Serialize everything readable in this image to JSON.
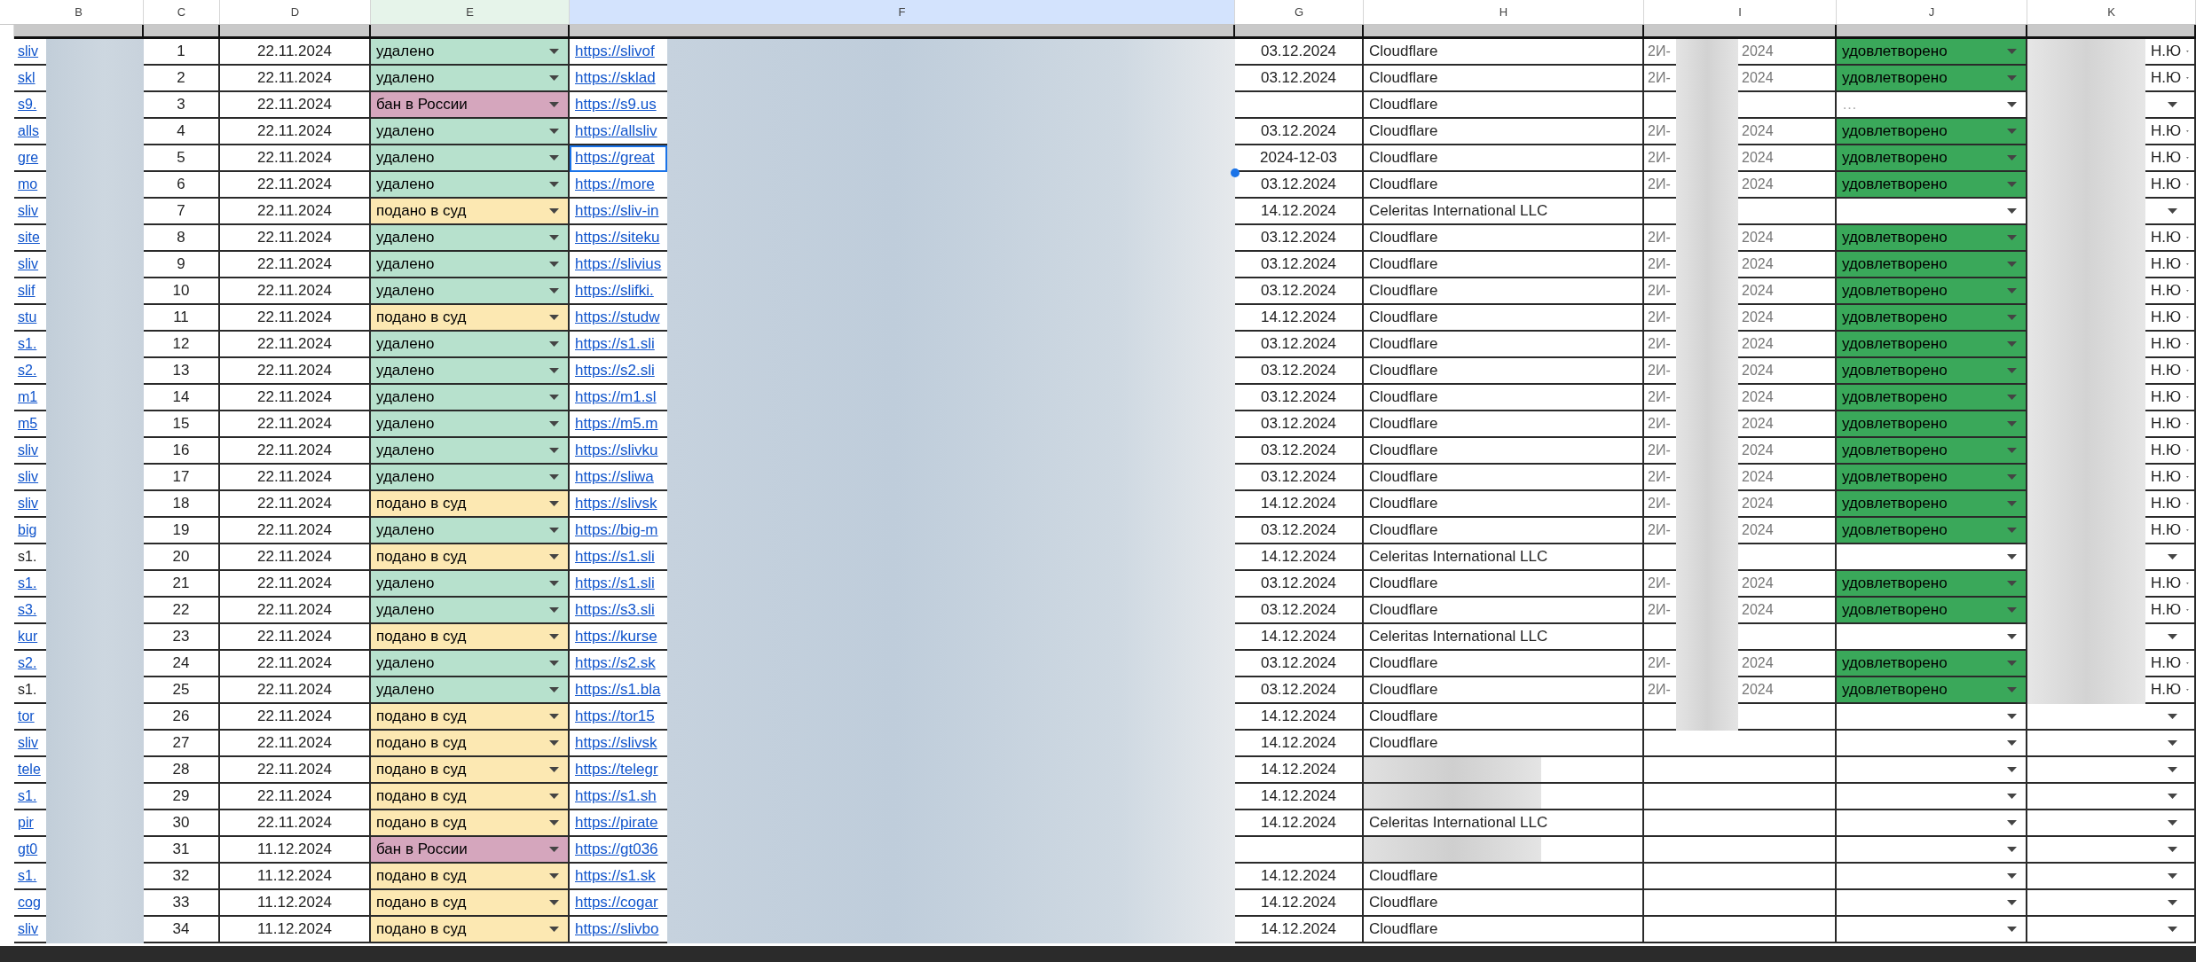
{
  "columns": [
    {
      "label": "B",
      "color": "#ffffff"
    },
    {
      "label": "C",
      "color": "#ffffff"
    },
    {
      "label": "D",
      "color": "#ffffff"
    },
    {
      "label": "E",
      "color": "#e6f4ea"
    },
    {
      "label": "F",
      "color": "#d3e3fd"
    },
    {
      "label": "G",
      "color": "#ffffff"
    },
    {
      "label": "H",
      "color": "#ffffff"
    },
    {
      "label": "I",
      "color": "#ffffff"
    },
    {
      "label": "J",
      "color": "#ffffff"
    },
    {
      "label": "K",
      "color": "#ffffff"
    }
  ],
  "rows": [
    {
      "b": "sliv",
      "b_link": true,
      "n": "1",
      "d": "22.11.2024",
      "status": {
        "label": "удалено",
        "color": "#b7e1cd"
      },
      "f": "https://slivof",
      "selected": false,
      "g": "03.12.2024",
      "h": "Cloudflare",
      "i_start": "2И-",
      "i_end": "2024",
      "decision": {
        "label": "удовлетворено",
        "color": "#3aa85a"
      },
      "k": "Н.Ю"
    },
    {
      "b": "skl",
      "b_link": true,
      "n": "2",
      "d": "22.11.2024",
      "status": {
        "label": "удалено",
        "color": "#b7e1cd"
      },
      "f": "https://sklad",
      "selected": false,
      "g": "03.12.2024",
      "h": "Cloudflare",
      "i_start": "2И-",
      "i_end": "2024",
      "decision": {
        "label": "удовлетворено",
        "color": "#3aa85a"
      },
      "k": "Н.Ю"
    },
    {
      "b": "s9.",
      "b_link": true,
      "n": "3",
      "d": "22.11.2024",
      "status": {
        "label": "бан в России",
        "color": "#d5a6bd"
      },
      "f": "https://s9.us",
      "selected": false,
      "h": "Cloudflare",
      "decision": {
        "placeholder": "…"
      }
    },
    {
      "b": "alls",
      "b_link": true,
      "n": "4",
      "d": "22.11.2024",
      "status": {
        "label": "удалено",
        "color": "#b7e1cd"
      },
      "f": "https://allsliv",
      "selected": false,
      "g": "03.12.2024",
      "h": "Cloudflare",
      "i_start": "2И-",
      "i_end": "2024",
      "decision": {
        "label": "удовлетворено",
        "color": "#3aa85a"
      },
      "k": "Н.Ю"
    },
    {
      "b": "gre",
      "b_link": true,
      "n": "5",
      "d": "22.11.2024",
      "status": {
        "label": "удалено",
        "color": "#b7e1cd"
      },
      "f": "https://great",
      "selected": true,
      "g": "2024-12-03",
      "h": "Cloudflare",
      "i_start": "2И-",
      "i_end": "2024",
      "decision": {
        "label": "удовлетворено",
        "color": "#3aa85a"
      },
      "k": "Н.Ю"
    },
    {
      "b": "mo",
      "b_link": true,
      "n": "6",
      "d": "22.11.2024",
      "status": {
        "label": "удалено",
        "color": "#b7e1cd"
      },
      "f": "https://more",
      "selected": false,
      "g": "03.12.2024",
      "h": "Cloudflare",
      "i_start": "2И-",
      "i_end": "2024",
      "decision": {
        "label": "удовлетворено",
        "color": "#3aa85a"
      },
      "k": "Н.Ю"
    },
    {
      "b": "sliv",
      "b_link": true,
      "n": "7",
      "d": "22.11.2024",
      "status": {
        "label": "подано в суд",
        "color": "#fce8b2"
      },
      "f": "https://sliv-in",
      "selected": false,
      "g": "14.12.2024",
      "h": "Celeritas International LLC"
    },
    {
      "b": "site",
      "b_link": true,
      "n": "8",
      "d": "22.11.2024",
      "status": {
        "label": "удалено",
        "color": "#b7e1cd"
      },
      "f": "https://siteku",
      "selected": false,
      "g": "03.12.2024",
      "h": "Cloudflare",
      "i_start": "2И-",
      "i_end": "2024",
      "decision": {
        "label": "удовлетворено",
        "color": "#3aa85a"
      },
      "k": "Н.Ю"
    },
    {
      "b": "sliv",
      "b_link": true,
      "n": "9",
      "d": "22.11.2024",
      "status": {
        "label": "удалено",
        "color": "#b7e1cd"
      },
      "f": "https://slivius",
      "selected": false,
      "g": "03.12.2024",
      "h": "Cloudflare",
      "i_start": "2И-",
      "i_end": "2024",
      "decision": {
        "label": "удовлетворено",
        "color": "#3aa85a"
      },
      "k": "Н.Ю"
    },
    {
      "b": "slif",
      "b_link": true,
      "n": "10",
      "d": "22.11.2024",
      "status": {
        "label": "удалено",
        "color": "#b7e1cd"
      },
      "f": "https://slifki.",
      "selected": false,
      "g": "03.12.2024",
      "h": "Cloudflare",
      "i_start": "2И-",
      "i_end": "2024",
      "decision": {
        "label": "удовлетворено",
        "color": "#3aa85a"
      },
      "k": "Н.Ю"
    },
    {
      "b": "stu",
      "b_link": true,
      "n": "11",
      "d": "22.11.2024",
      "status": {
        "label": "подано в суд",
        "color": "#fce8b2"
      },
      "f": "https://studw",
      "selected": false,
      "g": "14.12.2024",
      "h": "Cloudflare",
      "i_start": "2И-",
      "i_end": "2024",
      "decision": {
        "label": "удовлетворено",
        "color": "#3aa85a"
      },
      "k": "Н.Ю"
    },
    {
      "b": "s1.",
      "b_link": true,
      "n": "12",
      "d": "22.11.2024",
      "status": {
        "label": "удалено",
        "color": "#b7e1cd"
      },
      "f": "https://s1.sli",
      "selected": false,
      "g": "03.12.2024",
      "h": "Cloudflare",
      "i_start": "2И-",
      "i_end": "2024",
      "decision": {
        "label": "удовлетворено",
        "color": "#3aa85a"
      },
      "k": "Н.Ю"
    },
    {
      "b": "s2.",
      "b_link": true,
      "n": "13",
      "d": "22.11.2024",
      "status": {
        "label": "удалено",
        "color": "#b7e1cd"
      },
      "f": "https://s2.sli",
      "selected": false,
      "g": "03.12.2024",
      "h": "Cloudflare",
      "i_start": "2И-",
      "i_end": "2024",
      "decision": {
        "label": "удовлетворено",
        "color": "#3aa85a"
      },
      "k": "Н.Ю"
    },
    {
      "b": "m1",
      "b_link": true,
      "n": "14",
      "d": "22.11.2024",
      "status": {
        "label": "удалено",
        "color": "#b7e1cd"
      },
      "f": "https://m1.sl",
      "selected": false,
      "g": "03.12.2024",
      "h": "Cloudflare",
      "i_start": "2И-",
      "i_end": "2024",
      "decision": {
        "label": "удовлетворено",
        "color": "#3aa85a"
      },
      "k": "Н.Ю"
    },
    {
      "b": "m5",
      "b_link": true,
      "n": "15",
      "d": "22.11.2024",
      "status": {
        "label": "удалено",
        "color": "#b7e1cd"
      },
      "f": "https://m5.m",
      "selected": false,
      "g": "03.12.2024",
      "h": "Cloudflare",
      "i_start": "2И-",
      "i_end": "2024",
      "decision": {
        "label": "удовлетворено",
        "color": "#3aa85a"
      },
      "k": "Н.Ю"
    },
    {
      "b": "sliv",
      "b_link": true,
      "n": "16",
      "d": "22.11.2024",
      "status": {
        "label": "удалено",
        "color": "#b7e1cd"
      },
      "f": "https://slivku",
      "selected": false,
      "g": "03.12.2024",
      "h": "Cloudflare",
      "i_start": "2И-",
      "i_end": "2024",
      "decision": {
        "label": "удовлетворено",
        "color": "#3aa85a"
      },
      "k": "Н.Ю"
    },
    {
      "b": "sliv",
      "b_link": true,
      "n": "17",
      "d": "22.11.2024",
      "status": {
        "label": "удалено",
        "color": "#b7e1cd"
      },
      "f": "https://sliwa",
      "selected": false,
      "g": "03.12.2024",
      "h": "Cloudflare",
      "i_start": "2И-",
      "i_end": "2024",
      "decision": {
        "label": "удовлетворено",
        "color": "#3aa85a"
      },
      "k": "Н.Ю"
    },
    {
      "b": "sliv",
      "b_link": true,
      "n": "18",
      "d": "22.11.2024",
      "status": {
        "label": "подано в суд",
        "color": "#fce8b2"
      },
      "f": "https://slivsk",
      "selected": false,
      "g": "14.12.2024",
      "h": "Cloudflare",
      "i_start": "2И-",
      "i_end": "2024",
      "decision": {
        "label": "удовлетворено",
        "color": "#3aa85a"
      },
      "k": "Н.Ю"
    },
    {
      "b": "big",
      "b_link": true,
      "n": "19",
      "d": "22.11.2024",
      "status": {
        "label": "удалено",
        "color": "#b7e1cd"
      },
      "f": "https://big-m",
      "selected": false,
      "g": "03.12.2024",
      "h": "Cloudflare",
      "i_start": "2И-",
      "i_end": "2024",
      "decision": {
        "label": "удовлетворено",
        "color": "#3aa85a"
      },
      "k": "Н.Ю"
    },
    {
      "b": "s1.",
      "b_link": false,
      "n": "20",
      "d": "22.11.2024",
      "status": {
        "label": "подано в суд",
        "color": "#fce8b2"
      },
      "f": "https://s1.sli",
      "selected": false,
      "g": "14.12.2024",
      "h": "Celeritas International LLC"
    },
    {
      "b": "s1.",
      "b_link": true,
      "n": "21",
      "d": "22.11.2024",
      "status": {
        "label": "удалено",
        "color": "#b7e1cd"
      },
      "f": "https://s1.sli",
      "selected": false,
      "g": "03.12.2024",
      "h": "Cloudflare",
      "i_start": "2И-",
      "i_end": "2024",
      "decision": {
        "label": "удовлетворено",
        "color": "#3aa85a"
      },
      "k": "Н.Ю"
    },
    {
      "b": "s3.",
      "b_link": true,
      "n": "22",
      "d": "22.11.2024",
      "status": {
        "label": "удалено",
        "color": "#b7e1cd"
      },
      "f": "https://s3.sli",
      "selected": false,
      "g": "03.12.2024",
      "h": "Cloudflare",
      "i_start": "2И-",
      "i_end": "2024",
      "decision": {
        "label": "удовлетворено",
        "color": "#3aa85a"
      },
      "k": "Н.Ю"
    },
    {
      "b": "kur",
      "b_link": true,
      "n": "23",
      "d": "22.11.2024",
      "status": {
        "label": "подано в суд",
        "color": "#fce8b2"
      },
      "f": "https://kurse",
      "selected": false,
      "g": "14.12.2024",
      "h": "Celeritas International LLC"
    },
    {
      "b": "s2.",
      "b_link": true,
      "n": "24",
      "d": "22.11.2024",
      "status": {
        "label": "удалено",
        "color": "#b7e1cd"
      },
      "f": "https://s2.sk",
      "selected": false,
      "g": "03.12.2024",
      "h": "Cloudflare",
      "i_start": "2И-",
      "i_end": "2024",
      "decision": {
        "label": "удовлетворено",
        "color": "#3aa85a"
      },
      "k": "Н.Ю"
    },
    {
      "b": "s1.",
      "b_link": false,
      "n": "25",
      "d": "22.11.2024",
      "status": {
        "label": "удалено",
        "color": "#b7e1cd"
      },
      "f": "https://s1.bla",
      "selected": false,
      "g": "03.12.2024",
      "h": "Cloudflare",
      "i_start": "2И-",
      "i_end": "2024",
      "decision": {
        "label": "удовлетворено",
        "color": "#3aa85a"
      },
      "k": "Н.Ю"
    },
    {
      "b": "tor",
      "b_link": true,
      "n": "26",
      "d": "22.11.2024",
      "status": {
        "label": "подано в суд",
        "color": "#fce8b2"
      },
      "f": "https://tor15",
      "selected": false,
      "g": "14.12.2024",
      "h": "Cloudflare"
    },
    {
      "b": "sliv",
      "b_link": true,
      "n": "27",
      "d": "22.11.2024",
      "status": {
        "label": "подано в суд",
        "color": "#fce8b2"
      },
      "f": "https://slivsk",
      "selected": false,
      "g": "14.12.2024",
      "h": "Cloudflare"
    },
    {
      "b": "tele",
      "b_link": true,
      "n": "28",
      "d": "22.11.2024",
      "status": {
        "label": "подано в суд",
        "color": "#fce8b2"
      },
      "f": "https://telegr",
      "selected": false,
      "g": "14.12.2024"
    },
    {
      "b": "s1.",
      "b_link": true,
      "n": "29",
      "d": "22.11.2024",
      "status": {
        "label": "подано в суд",
        "color": "#fce8b2"
      },
      "f": "https://s1.sh",
      "selected": false,
      "g": "14.12.2024"
    },
    {
      "b": "pir",
      "b_link": true,
      "n": "30",
      "d": "22.11.2024",
      "status": {
        "label": "подано в суд",
        "color": "#fce8b2"
      },
      "f": "https://pirate",
      "selected": false,
      "g": "14.12.2024",
      "h": "Celeritas International LLC"
    },
    {
      "b": "gt0",
      "b_link": true,
      "n": "31",
      "d": "11.12.2024",
      "status": {
        "label": "бан в России",
        "color": "#d5a6bd"
      },
      "f": "https://gt036",
      "selected": false
    },
    {
      "b": "s1.",
      "b_link": true,
      "n": "32",
      "d": "11.12.2024",
      "status": {
        "label": "подано в суд",
        "color": "#fce8b2"
      },
      "f": "https://s1.sk",
      "selected": false,
      "g": "14.12.2024",
      "h": "Cloudflare"
    },
    {
      "b": "cog",
      "b_link": true,
      "n": "33",
      "d": "11.12.2024",
      "status": {
        "label": "подано в суд",
        "color": "#fce8b2"
      },
      "f": "https://cogar",
      "selected": false,
      "g": "14.12.2024",
      "h": "Cloudflare"
    },
    {
      "b": "sliv",
      "b_link": true,
      "n": "34",
      "d": "11.12.2024",
      "status": {
        "label": "подано в суд",
        "color": "#fce8b2"
      },
      "f": "https://slivbo",
      "selected": false,
      "g": "14.12.2024",
      "h": "Cloudflare"
    }
  ]
}
